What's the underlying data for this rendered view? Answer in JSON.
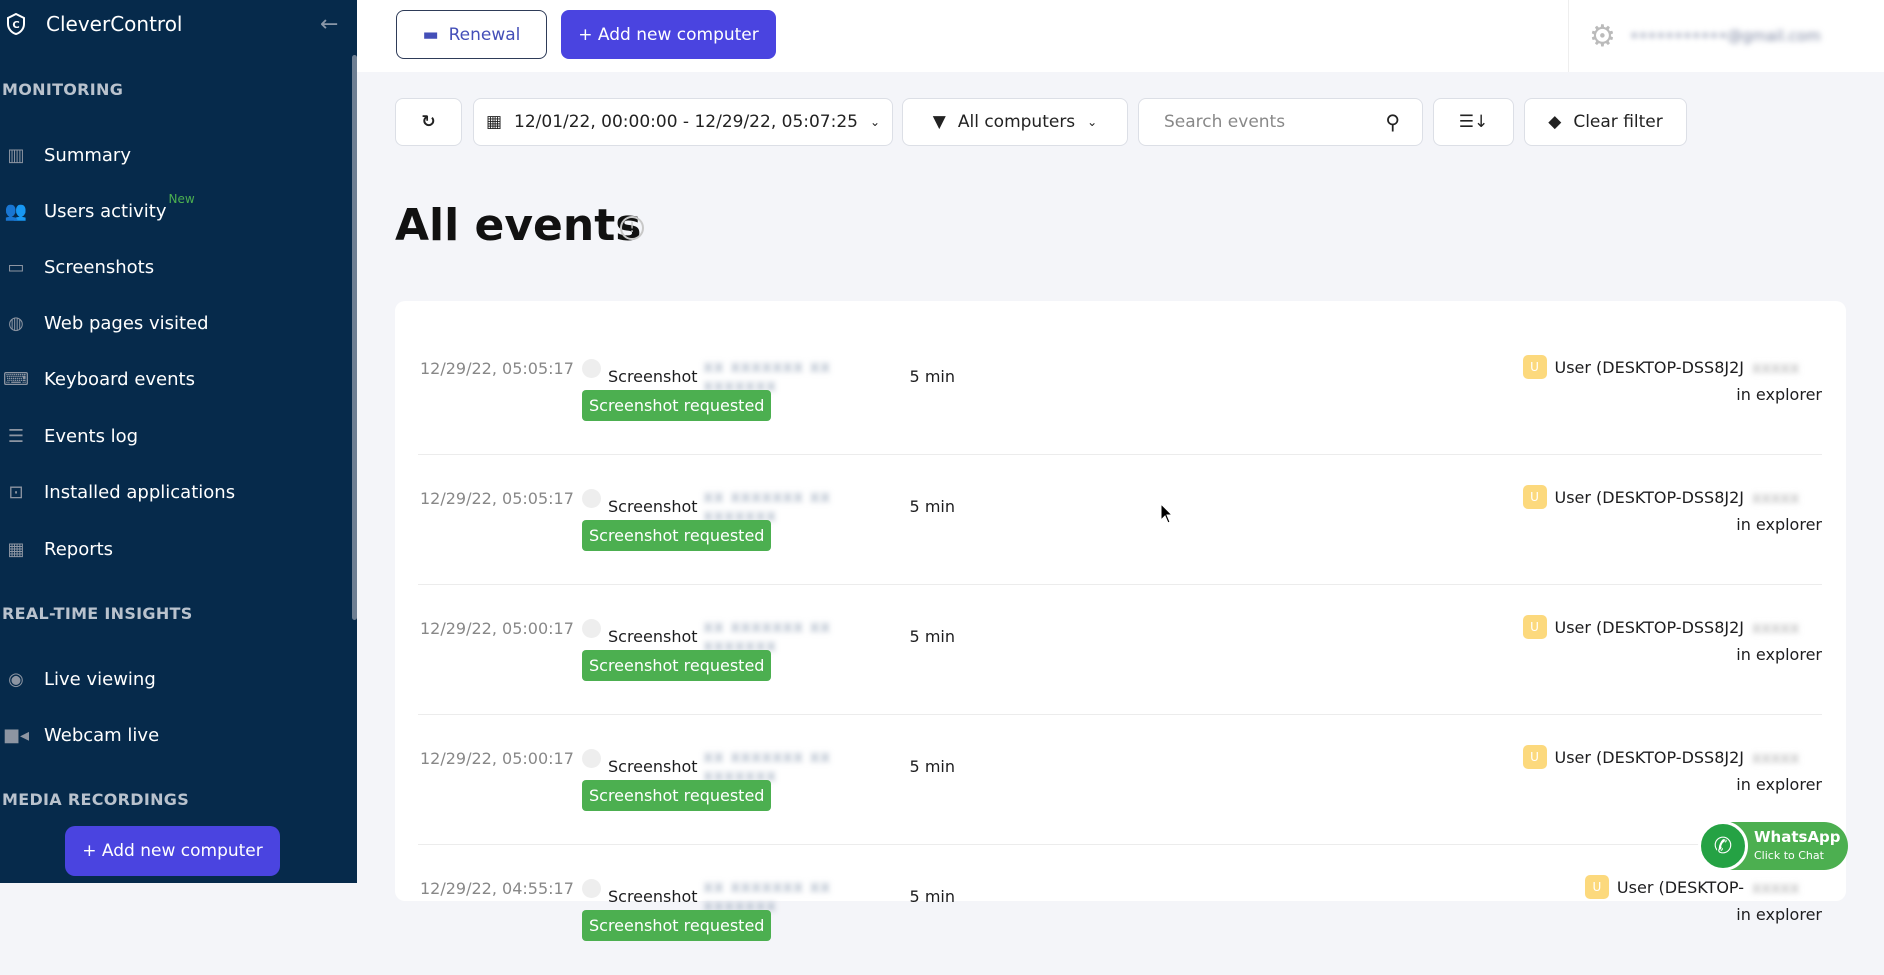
{
  "sidebar": {
    "brand": "CleverControl",
    "sections": [
      "MONITORING",
      "REAL-TIME INSIGHTS",
      "MEDIA RECORDINGS"
    ],
    "items": [
      {
        "label": "Summary"
      },
      {
        "label": "Users activity",
        "badge": "New"
      },
      {
        "label": "Screenshots"
      },
      {
        "label": "Web pages visited"
      },
      {
        "label": "Keyboard events"
      },
      {
        "label": "Events log"
      },
      {
        "label": "Installed applications"
      },
      {
        "label": "Reports"
      },
      {
        "label": "Live viewing"
      },
      {
        "label": "Webcam live"
      }
    ],
    "add_button": "+ Add new computer"
  },
  "topbar": {
    "renewal": "Renewal",
    "add": "+ Add new computer",
    "account": "•••••••••••@gmail.com"
  },
  "filters": {
    "date_range": "12/01/22, 00:00:00 - 12/29/22, 05:07:25",
    "computers": "All computers",
    "search_placeholder": "Search events",
    "clear": "Clear filter"
  },
  "page_title": "All events",
  "events": [
    {
      "time": "12/29/22, 05:05:17",
      "type": "Screenshot",
      "hidden": "xx xxxxxxx xx xxxxxxx",
      "duration": "5 min",
      "badge": "Screenshot requested",
      "user": "User (DESKTOP-DSS8J2J",
      "user_hidden": "xxxxx",
      "where": "in explorer"
    },
    {
      "time": "12/29/22, 05:05:17",
      "type": "Screenshot",
      "hidden": "xx xxxxxxx xx xxxxxxx",
      "duration": "5 min",
      "badge": "Screenshot requested",
      "user": "User (DESKTOP-DSS8J2J",
      "user_hidden": "xxxxx",
      "where": "in explorer"
    },
    {
      "time": "12/29/22, 05:00:17",
      "type": "Screenshot",
      "hidden": "xx xxxxxxx xx xxxxxxx",
      "duration": "5 min",
      "badge": "Screenshot requested",
      "user": "User (DESKTOP-DSS8J2J",
      "user_hidden": "xxxxx",
      "where": "in explorer"
    },
    {
      "time": "12/29/22, 05:00:17",
      "type": "Screenshot",
      "hidden": "xx xxxxxxx xx xxxxxxx",
      "duration": "5 min",
      "badge": "Screenshot requested",
      "user": "User (DESKTOP-DSS8J2J",
      "user_hidden": "xxxxx",
      "where": "in explorer"
    },
    {
      "time": "12/29/22, 04:55:17",
      "type": "Screenshot",
      "hidden": "xx xxxxxxx xx xxxxxxx",
      "duration": "5 min",
      "badge": "Screenshot requested",
      "user": "User (DESKTOP-",
      "user_hidden": "xxxxx",
      "where": "in explorer"
    }
  ],
  "avatar_letter": "U",
  "whatsapp": {
    "title": "WhatsApp",
    "sub": "Click to Chat"
  }
}
